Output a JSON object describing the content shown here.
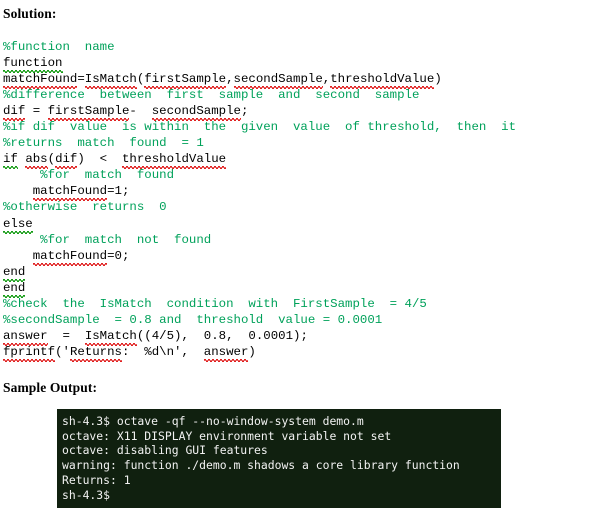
{
  "document": {
    "headings": {
      "solution": "Solution:",
      "sample_output": "Sample Output:"
    },
    "colors": {
      "comment_green": "#00A15A",
      "code_black": "#000000",
      "terminal_bg": "#10200F",
      "terminal_fg": "#F2F2F2",
      "spellcheck_red": "#E02020",
      "grammar_green": "#169C16"
    },
    "code_lines": [
      {
        "kind": "comment",
        "text": "%function  name"
      },
      {
        "kind": "code",
        "text": "function"
      },
      {
        "kind": "code",
        "text": "matchFound=IsMatch(firstSample,secondSample,thresholdValue)"
      },
      {
        "kind": "comment",
        "text": "%difference  between  first  sample  and  second  sample"
      },
      {
        "kind": "code",
        "text": "dif = firstSample-  secondSample;"
      },
      {
        "kind": "comment",
        "text": "%if dif  value  is within  the  given  value  of threshold,  then  it"
      },
      {
        "kind": "comment",
        "text": "%returns  match  found  = 1"
      },
      {
        "kind": "code",
        "text": "if abs(dif)  <  thresholdValue"
      },
      {
        "kind": "comment",
        "text": "     %for  match  found"
      },
      {
        "kind": "code",
        "text": "    matchFound=1;"
      },
      {
        "kind": "comment",
        "text": "%otherwise  returns  0"
      },
      {
        "kind": "code",
        "text": "else"
      },
      {
        "kind": "comment",
        "text": "     %for  match  not  found"
      },
      {
        "kind": "code",
        "text": "    matchFound=0;"
      },
      {
        "kind": "code",
        "text": "end"
      },
      {
        "kind": "code",
        "text": "end"
      },
      {
        "kind": "comment",
        "text": "%check  the  IsMatch  condition  with  FirstSample  = 4/5"
      },
      {
        "kind": "comment",
        "text": "%secondSample  = 0.8 and  threshold  value = 0.0001"
      },
      {
        "kind": "code",
        "text": "answer  =  IsMatch((4/5),  0.8,  0.0001);"
      },
      {
        "kind": "code",
        "text": "fprintf('Returns:  %d\\n',  answer)"
      }
    ],
    "terminal": {
      "lines": [
        "sh-4.3$ octave -qf --no-window-system demo.m",
        "octave: X11 DISPLAY environment variable not set",
        "octave: disabling GUI features",
        "warning: function ./demo.m shadows a core library function",
        "Returns: 1",
        "sh-4.3$"
      ]
    }
  }
}
